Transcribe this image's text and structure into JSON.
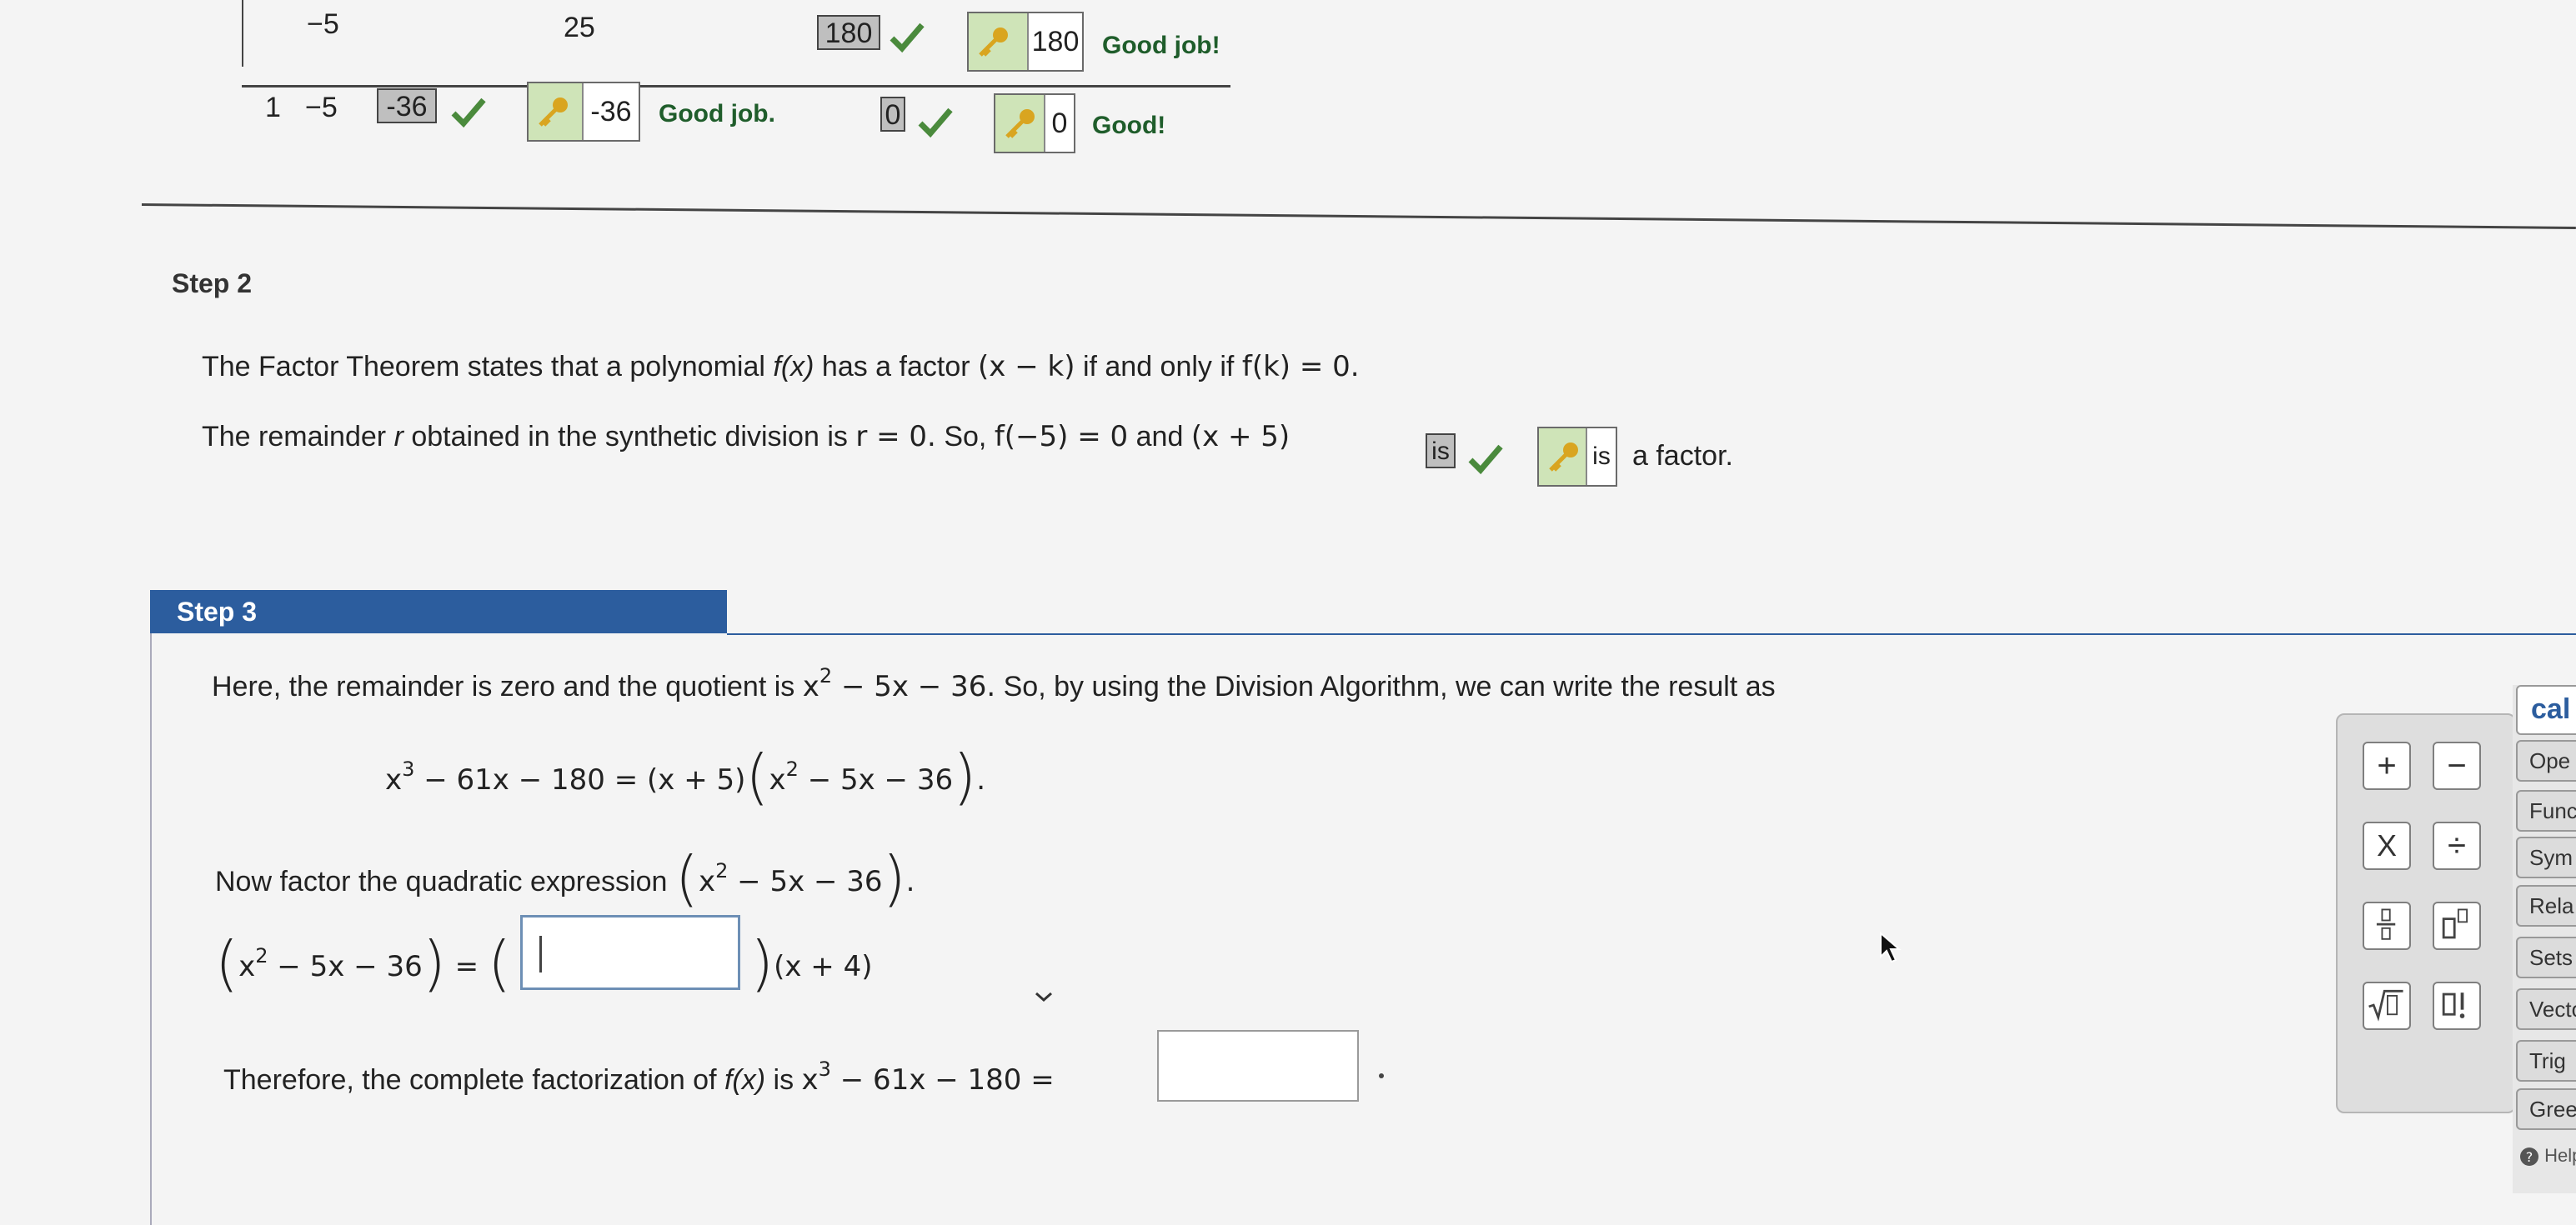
{
  "synthetic_division": {
    "row1": {
      "col1": "−5",
      "col2": "25",
      "col3_answer": "180",
      "col3_key_value": "180",
      "col3_feedback": "Good job!"
    },
    "row2": {
      "lead": "1",
      "col1": "−5",
      "col2_answer": "-36",
      "col2_key_value": "-36",
      "col2_feedback": "Good job.",
      "col3_answer": "0",
      "col3_key_value": "0",
      "col3_feedback": "Good!"
    }
  },
  "step2": {
    "heading": "Step 2",
    "line1": {
      "a": "The Factor Theorem states that a polynomial",
      "fx": "f(x)",
      "b": "has a factor",
      "xk": "(x − k)",
      "c": "if and only if",
      "fk": "f(k) = 0."
    },
    "line2": {
      "a": "The remainder",
      "r": "r",
      "b": "obtained in the synthetic division is",
      "req": "r = 0.",
      "c": "So,",
      "f5": "f(−5) = 0",
      "d": "and",
      "x5": "(x + 5)",
      "answer": "is",
      "key_value": "is",
      "e": "a factor."
    }
  },
  "step3": {
    "heading": "Step 3",
    "intro_a": "Here, the remainder is zero and the quotient is",
    "intro_quot": "x",
    "intro_quot_rest": " − 5x − 36.",
    "intro_b": "So, by using the Division Algorithm, we can write the result as",
    "eq_lhs": "x",
    "eq_lhs_rest": " − 61x − 180 = (x + 5)",
    "eq_quad": "x",
    "eq_quad_rest": " − 5x − 36",
    "factor_prompt": "Now factor the quadratic expression",
    "factor_expr_lhs": "x",
    "factor_expr_rest": " − 5x − 36",
    "factor_row_rhs": "(x + 4)",
    "final_a": "Therefore, the complete factorization of",
    "final_fx": "f(x)",
    "final_b": "is",
    "final_expr": "x",
    "final_expr_rest": " − 61x − 180 =",
    "sup2": "2",
    "sup3": "3"
  },
  "palette": {
    "plus": "+",
    "minus": "−",
    "times": "X",
    "divide": "÷",
    "fraction": "▯/▯",
    "power": "▯▯",
    "sqrt": "√▯",
    "factorial": "▯!"
  },
  "sidebar": {
    "title": "cal",
    "tabs": [
      "Ope",
      "Func",
      "Sym",
      "Rela",
      "Sets",
      "Vecto",
      "Trig",
      "Greek"
    ],
    "help": "Help"
  },
  "colors": {
    "accent": "#2c5d9e",
    "correct_bg": "#cfe4b8",
    "check": "#4a8a3c"
  }
}
